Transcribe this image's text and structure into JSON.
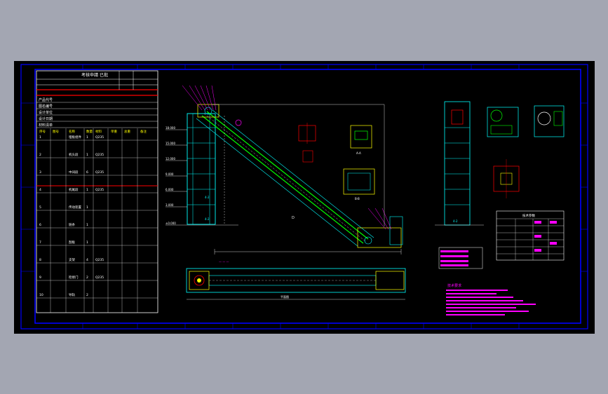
{
  "drawing": {
    "title_block": {
      "heading": "考核申請 已批",
      "row_labels": [
        "产品代号",
        "图名编号",
        "设计单位",
        "设计日期",
        "材料清单"
      ],
      "parts_header": [
        "序号",
        "图号",
        "名称",
        "数量",
        "材料",
        "单重",
        "总重",
        "备注"
      ],
      "parts_rows": [
        [
          "1",
          "",
          "埋板组件",
          "1",
          "Q235",
          "",
          ""
        ],
        [
          "2",
          "",
          "机头段",
          "1",
          "Q235",
          "",
          ""
        ],
        [
          "3",
          "",
          "中间段",
          "6",
          "Q235",
          "",
          ""
        ],
        [
          "4",
          "",
          "机尾段",
          "1",
          "Q235",
          "",
          ""
        ],
        [
          "5",
          "",
          "传动装置",
          "1",
          "",
          "",
          ""
        ],
        [
          "6",
          "",
          "链条",
          "1",
          "",
          "",
          ""
        ],
        [
          "7",
          "",
          "刮板",
          "1",
          "",
          "",
          ""
        ],
        [
          "8",
          "",
          "支架",
          "4",
          "Q235",
          "",
          ""
        ],
        [
          "9",
          "",
          "检修门",
          "2",
          "Q235",
          "",
          ""
        ],
        [
          "10",
          "",
          "导轨",
          "2",
          "",
          "",
          ""
        ]
      ]
    },
    "views": {
      "elevation_marks": [
        "18.000",
        "15.000",
        "12.000",
        "9.000",
        "6.000",
        "3.000",
        "±0.000"
      ],
      "section_labels": [
        "A-A",
        "B-B",
        "C-C",
        "D"
      ],
      "plan_label": "平面图",
      "notes_header": "技术要求",
      "spec_table_header": "技术参数"
    },
    "colors": {
      "sheet": "#000000",
      "frame": "#0000ff",
      "table_red": "#ff0000",
      "cyan": "#00ffff",
      "yellow": "#ffff00",
      "magenta": "#ff00ff",
      "green": "#00ff00",
      "white": "#ffffff"
    }
  }
}
